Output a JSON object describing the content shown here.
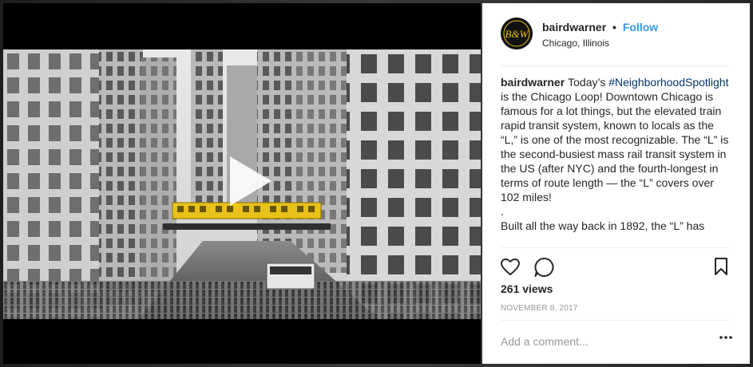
{
  "post": {
    "username": "bairdwarner",
    "separator": "•",
    "follow_label": "Follow",
    "location": "Chicago, Illinois",
    "avatar_text": "B&W",
    "caption": {
      "username": "bairdwarner",
      "lead": "Today’s",
      "hashtag": "#NeighborhoodSpotlight",
      "body": "is the Chicago Loop! Downtown Chicago is famous for a lot things, but the elevated train rapid transit system, known to locals as the “L,” is one of the most recognizable. The “L” is the second-busiest mass rail transit system in the US (after NYC) and the fourth-longest in terms of route length — the “L” covers over 102 miles!",
      "dot": ".",
      "continuation": "Built all the way back in 1892, the “L” has"
    },
    "views": "261 views",
    "date": "NOVEMBER 8, 2017",
    "comment_placeholder": "Add a comment...",
    "colors": {
      "follow": "#3897f0",
      "hashtag": "#003569",
      "train_highlight": "#e8c21a"
    },
    "icons": [
      "play-icon",
      "heart-icon",
      "comment-icon",
      "bookmark-icon",
      "more-options-icon"
    ]
  }
}
